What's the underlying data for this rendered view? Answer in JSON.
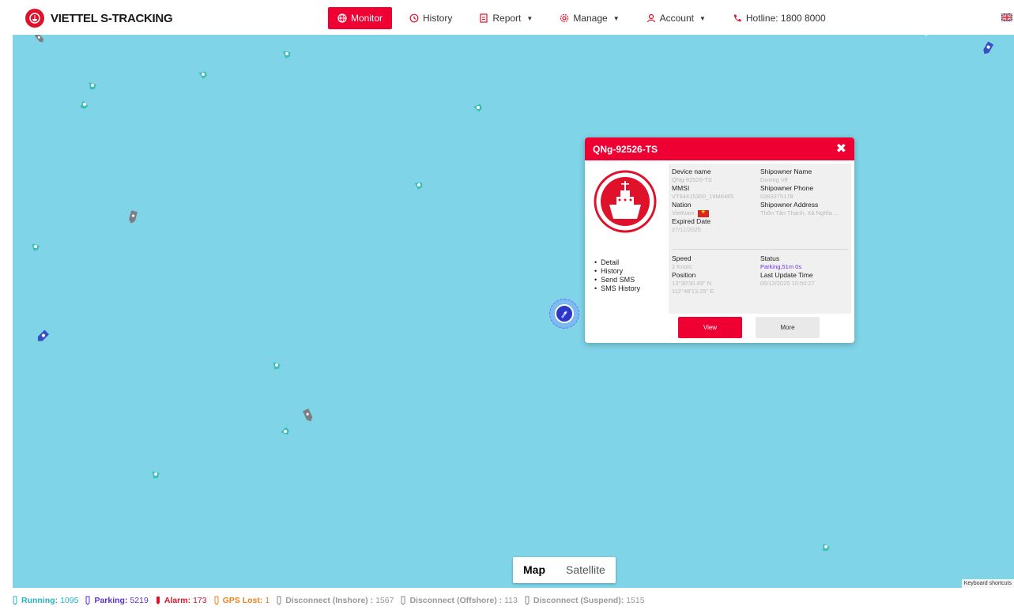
{
  "app": {
    "title": "VIETTEL S-TRACKING"
  },
  "nav": {
    "monitor": "Monitor",
    "history": "History",
    "report": "Report",
    "manage": "Manage",
    "account": "Account",
    "hotline": "Hotline: 1800 8000"
  },
  "map": {
    "toggle_map": "Map",
    "toggle_satellite": "Satellite",
    "keyboard_shortcuts": "Keyboard shortcuts"
  },
  "popup": {
    "title": "QNg-92526-TS",
    "menu": [
      "Detail",
      "History",
      "Send SMS",
      "SMS History"
    ],
    "device_name_label": "Device name",
    "device_name": "QNg-92526-TS",
    "mmsi_label": "MMSI",
    "mmsi": "VT64415300_19M6485",
    "nation_label": "Nation",
    "nation": "VietNam",
    "expired_label": "Expired Date",
    "expired": "27/11/2025",
    "owner_name_label": "Shipowner Name",
    "owner_name": "Dương Vệ",
    "owner_phone_label": "Shipowner Phone",
    "owner_phone": "0383375178",
    "owner_address_label": "Shipowner Address",
    "owner_address": "Thôn Tân Thạnh, Xã Nghĩa ...",
    "speed_label": "Speed",
    "speed": "2 Knots",
    "position_label": "Position",
    "position_lat": "13°30'30.89\" N",
    "position_lon": "112°48'13.25\" E",
    "status_label": "Status",
    "status": "Parking,51m 0s",
    "last_update_label": "Last Update Time",
    "last_update": "05/12/2025 10:50:27",
    "view_button": "View",
    "more_button": "More"
  },
  "status_bar": {
    "running_label": "Running:",
    "running": "1095",
    "parking_label": "Parking:",
    "parking": "5219",
    "alarm_label": "Alarm:",
    "alarm": "173",
    "gps_label": "GPS Lost:",
    "gps": "1",
    "disc_inshore_label": "Disconnect (Inshore) :",
    "disc_inshore": "1567",
    "disc_offshore_label": "Disconnect (Offshore) :",
    "disc_offshore": "113",
    "disc_suspend_label": "Disconnect (Suspend):",
    "disc_suspend": "1515"
  },
  "colors": {
    "brand": "#ee0033",
    "sea": "#7fd4e8",
    "running": "#26b3c3",
    "parking": "#5b2fd8",
    "alarm": "#e0112b",
    "gps_lost": "#f0821e",
    "disconnect": "#999999"
  }
}
